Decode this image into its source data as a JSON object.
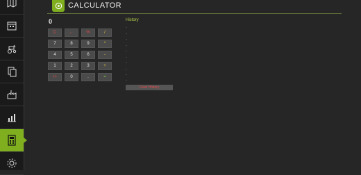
{
  "header": {
    "title": "CALCULATOR",
    "icon": "calculator-gear-icon"
  },
  "sidebar": {
    "items": [
      {
        "name": "map-icon",
        "active": false
      },
      {
        "name": "calendar-icon",
        "active": false
      },
      {
        "name": "tractor-icon",
        "active": false
      },
      {
        "name": "documents-icon",
        "active": false
      },
      {
        "name": "factory-icon",
        "active": false
      },
      {
        "name": "statistics-icon",
        "active": false
      },
      {
        "name": "calculator-icon",
        "active": true
      },
      {
        "name": "settings-icon",
        "active": false
      }
    ]
  },
  "calculator": {
    "display": "0",
    "keys": [
      {
        "label": "C",
        "style": "red"
      },
      {
        "label": "←",
        "style": "red"
      },
      {
        "label": "%",
        "style": "red"
      },
      {
        "label": "/",
        "style": "yellow"
      },
      {
        "label": "7",
        "style": ""
      },
      {
        "label": "8",
        "style": ""
      },
      {
        "label": "9",
        "style": ""
      },
      {
        "label": "*",
        "style": "yellow"
      },
      {
        "label": "4",
        "style": ""
      },
      {
        "label": "5",
        "style": ""
      },
      {
        "label": "6",
        "style": ""
      },
      {
        "label": "-",
        "style": "yellow"
      },
      {
        "label": "1",
        "style": ""
      },
      {
        "label": "2",
        "style": ""
      },
      {
        "label": "3",
        "style": ""
      },
      {
        "label": "+",
        "style": "yellow"
      },
      {
        "label": "+/-",
        "style": "red"
      },
      {
        "label": "0",
        "style": ""
      },
      {
        "label": ".",
        "style": ""
      },
      {
        "label": "=",
        "style": "green"
      }
    ]
  },
  "history": {
    "title": "History",
    "entries": [
      "-",
      "-",
      "-",
      "-",
      "-",
      "-",
      "-",
      "-",
      "-",
      "-"
    ],
    "clear_label": "Clear History"
  }
}
